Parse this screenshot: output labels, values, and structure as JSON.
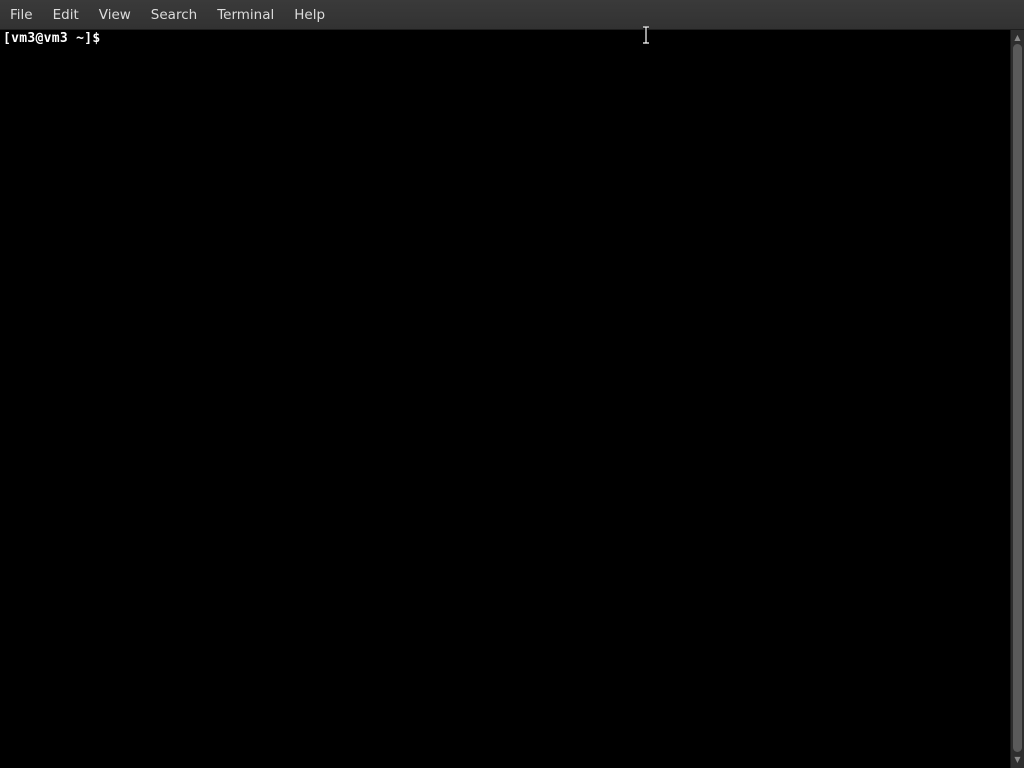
{
  "menubar": {
    "items": [
      {
        "label": "File"
      },
      {
        "label": "Edit"
      },
      {
        "label": "View"
      },
      {
        "label": "Search"
      },
      {
        "label": "Terminal"
      },
      {
        "label": "Help"
      }
    ]
  },
  "terminal": {
    "prompt": "[vm3@vm3 ~]$",
    "background_color": "#000000",
    "text_color": "#ffffff"
  },
  "icons": {
    "scroll_up": "scroll-up-arrow-icon",
    "scroll_down": "scroll-down-arrow-icon",
    "mouse_cursor": "ibeam-cursor-icon"
  }
}
